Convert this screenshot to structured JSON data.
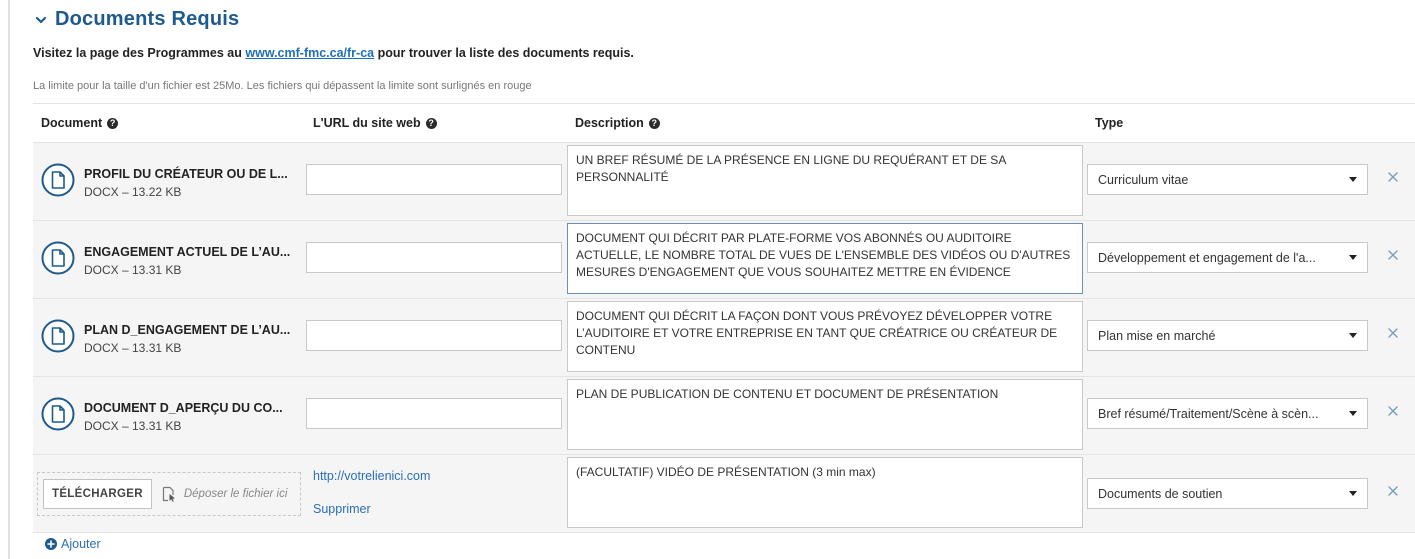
{
  "section": {
    "title": "Documents Requis"
  },
  "intro": {
    "before": "Visitez la page des Programmes au ",
    "link": "www.cmf-fmc.ca/fr-ca",
    "after": " pour trouver la liste des documents requis."
  },
  "limit_note": "La limite pour la taille d'un fichier est 25Mo. Les fichiers qui dépassent la limite sont surlignés en rouge",
  "table": {
    "headers": {
      "document": "Document",
      "url": "L'URL du site web",
      "description": "Description",
      "type": "Type"
    },
    "rows": [
      {
        "name": "PROFIL DU CRÉATEUR OU DE L...",
        "meta": "DOCX – 13.22 KB",
        "url_value": "",
        "description": "UN BREF RÉSUMÉ DE LA PRÉSENCE EN LIGNE DU REQUÉRANT ET DE SA PERSONNALITÉ",
        "type": "Curriculum vitae"
      },
      {
        "name": "ENGAGEMENT ACTUEL DE L’AU...",
        "meta": "DOCX – 13.31 KB",
        "url_value": "",
        "description": "DOCUMENT QUI DÉCRIT PAR PLATE-FORME VOS ABONNÉS OU AUDITOIRE ACTUELLE, LE NOMBRE TOTAL DE VUES DE L'ENSEMBLE DES VIDÉOS OU D'AUTRES MESURES D'ENGAGEMENT QUE VOUS SOUHAITEZ METTRE EN ÉVIDENCE",
        "type": "Développement et engagement de l'a..."
      },
      {
        "name": "PLAN D_ENGAGEMENT DE L’AU...",
        "meta": "DOCX – 13.31 KB",
        "url_value": "",
        "description": "DOCUMENT QUI DÉCRIT LA FAÇON DONT VOUS PRÉVOYEZ DÉVELOPPER VOTRE L’AUDITOIRE ET VOTRE ENTREPRISE EN TANT QUE CRÉATRICE OU CRÉATEUR DE CONTENU",
        "type": "Plan mise en marché"
      },
      {
        "name": "DOCUMENT D_APERÇU DU CO...",
        "meta": "DOCX – 13.31 KB",
        "url_value": "",
        "description": "PLAN DE PUBLICATION DE CONTENU ET DOCUMENT DE PRÉSENTATION",
        "type": "Bref résumé/Traitement/Scène à scèn..."
      }
    ],
    "upload_row": {
      "upload_label": "TÉLÉCHARGER",
      "drop_text": "Déposer le fichier ici",
      "link": "http://votrelienici.com",
      "delete_label": "Supprimer",
      "description": "(FACULTATIF) VIDÉO DE PRÉSENTATION (3 min max)",
      "type": "Documents de soutien"
    }
  },
  "add_label": "Ajouter",
  "colors": {
    "title": "#1e5a8c",
    "link": "#2a6ebb",
    "icon": "#1e5a8c",
    "row_bg": "#f5f5f5"
  },
  "icons": [
    "chevron-down-icon",
    "help-icon",
    "document-icon",
    "caret-down-icon",
    "close-icon",
    "drop-file-icon",
    "plus-circle-icon"
  ]
}
